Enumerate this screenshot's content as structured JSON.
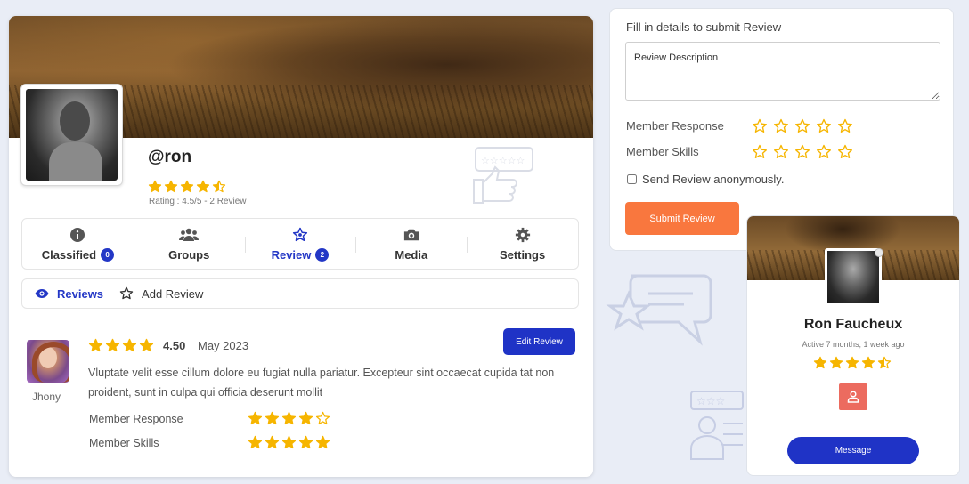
{
  "profile": {
    "username": "@ron",
    "rating_stars": 4.5,
    "rating_text": "Rating : 4.5/5 - 2 Review"
  },
  "tabs": [
    {
      "label": "Classified",
      "icon": "info-icon",
      "badge": "0",
      "active": false
    },
    {
      "label": "Groups",
      "icon": "users-icon",
      "badge": "",
      "active": false
    },
    {
      "label": "Review",
      "icon": "star-outline-icon",
      "badge": "2",
      "active": true
    },
    {
      "label": "Media",
      "icon": "camera-icon",
      "badge": "",
      "active": false
    },
    {
      "label": "Settings",
      "icon": "gear-icon",
      "badge": "",
      "active": false
    }
  ],
  "subtabs": {
    "reviews": "Reviews",
    "add_review": "Add Review"
  },
  "review": {
    "reviewer": "Jhony",
    "stars": 4,
    "score": "4.50",
    "date": "May 2023",
    "edit_label": "Edit Review",
    "text": "Vluptate velit esse cillum dolore eu fugiat nulla pariatur. Excepteur sint occaecat cupida tat non proident, sunt in culpa qui officia deserunt mollit",
    "metrics": [
      {
        "label": "Member Response",
        "stars": 4
      },
      {
        "label": "Member Skills",
        "stars": 5
      }
    ]
  },
  "form": {
    "title": "Fill in details to submit Review",
    "description_placeholder": "Review Description",
    "rows": [
      {
        "label": "Member Response",
        "stars": 0
      },
      {
        "label": "Member Skills",
        "stars": 0
      }
    ],
    "anonymous_label": "Send Review anonymously.",
    "submit_label": "Submit Review"
  },
  "member_card": {
    "name": "Ron Faucheux",
    "active": "Active 7 months, 1 week ago",
    "stars": 4.5,
    "message_label": "Message"
  },
  "colors": {
    "accent_blue": "#2337c6",
    "star_gold": "#f6b500",
    "submit_orange": "#f9773e",
    "user_button_red": "#ec6b5f"
  }
}
